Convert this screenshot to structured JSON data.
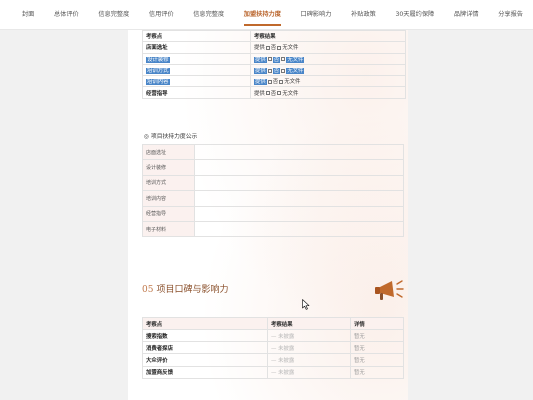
{
  "nav": {
    "items": [
      "封面",
      "总体评价",
      "信息完整度",
      "信用评价",
      "信息完整度",
      "加盟扶持力度",
      "口碑影响力",
      "补贴政策",
      "30天履约保障",
      "品牌详情",
      "分享报告"
    ],
    "active_index": 5
  },
  "table1": {
    "header": [
      "考察点",
      "考察结果"
    ],
    "rows": [
      {
        "item": "店面选址",
        "result": "提供",
        "status": "否",
        "tail": "无文件",
        "item_highlight": false,
        "tail_highlight": true
      },
      {
        "item": "设计装修",
        "result": "提供",
        "status": "否",
        "tail": "无文件",
        "item_highlight": true,
        "tail_highlight": true
      },
      {
        "item": "培训方式",
        "result": "提供",
        "status": "否",
        "tail": "无文件",
        "item_highlight": true,
        "tail_highlight": true
      },
      {
        "item": "培训内容",
        "result": "提供",
        "status": "否",
        "tail": "无文件",
        "item_highlight": true,
        "tail_highlight": false
      },
      {
        "item": "经营指导",
        "result": "提供",
        "status": "否",
        "tail": "无文件",
        "item_highlight": false,
        "tail_highlight": false
      }
    ]
  },
  "disclosure": {
    "title": "项目扶持力度公示",
    "rows": [
      "店面选址",
      "设计装修",
      "培训方式",
      "培训内容",
      "经营指导",
      "电子材料"
    ]
  },
  "section05": {
    "number": "05",
    "title": "项目口碑与影响力"
  },
  "table3": {
    "header": [
      "考察点",
      "考察结果",
      "详情"
    ],
    "rows": [
      {
        "item": "搜索指数",
        "result": "未披露",
        "detail": "暂无"
      },
      {
        "item": "消费者探店",
        "result": "未披露",
        "detail": "暂无"
      },
      {
        "item": "大众评价",
        "result": "未披露",
        "detail": "暂无"
      },
      {
        "item": "加盟商反馈",
        "result": "未披露",
        "detail": "暂无"
      }
    ]
  },
  "icons": {
    "megaphone": "megaphone-icon",
    "cursor": "mouse-cursor-icon"
  },
  "colors": {
    "accent": "#c0692c",
    "highlight": "#4a86c8",
    "label_bg": "#fbf1ef"
  }
}
